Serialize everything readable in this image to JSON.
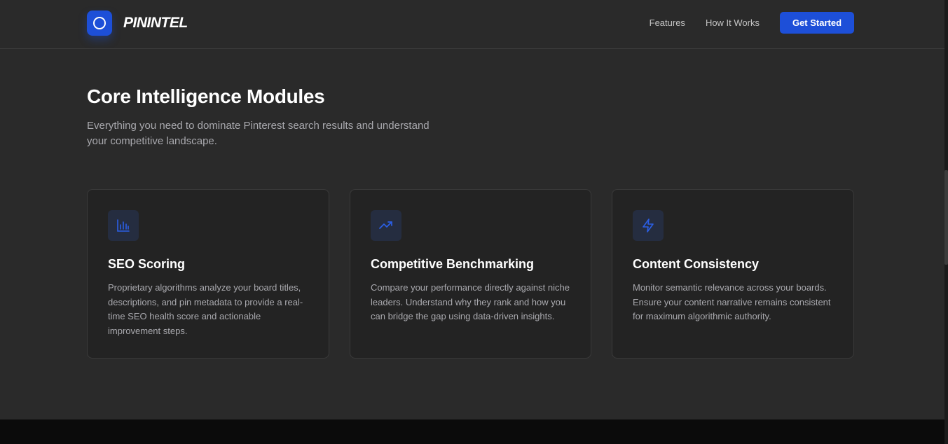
{
  "header": {
    "brand": "PININTEL",
    "nav": [
      "Features",
      "How It Works"
    ],
    "cta": "Get Started"
  },
  "section": {
    "title": "Core Intelligence Modules",
    "subtitle": "Everything you need to dominate Pinterest search results and understand your competitive landscape."
  },
  "cards": [
    {
      "icon": "bar-chart-icon",
      "title": "SEO Scoring",
      "description": "Proprietary algorithms analyze your board titles, descriptions, and pin metadata to provide a real-time SEO health score and actionable improvement steps."
    },
    {
      "icon": "trending-up-icon",
      "title": "Competitive Benchmarking",
      "description": "Compare your performance directly against niche leaders. Understand why they rank and how you can bridge the gap using data-driven insights."
    },
    {
      "icon": "lightning-icon",
      "title": "Content Consistency",
      "description": "Monitor semantic relevance across your boards. Ensure your content narrative remains consistent for maximum algorithmic authority."
    }
  ],
  "colors": {
    "accent": "#1d4fd8",
    "background": "#2a2a2a",
    "card": "#232323",
    "icon_tile": "#252d40"
  }
}
